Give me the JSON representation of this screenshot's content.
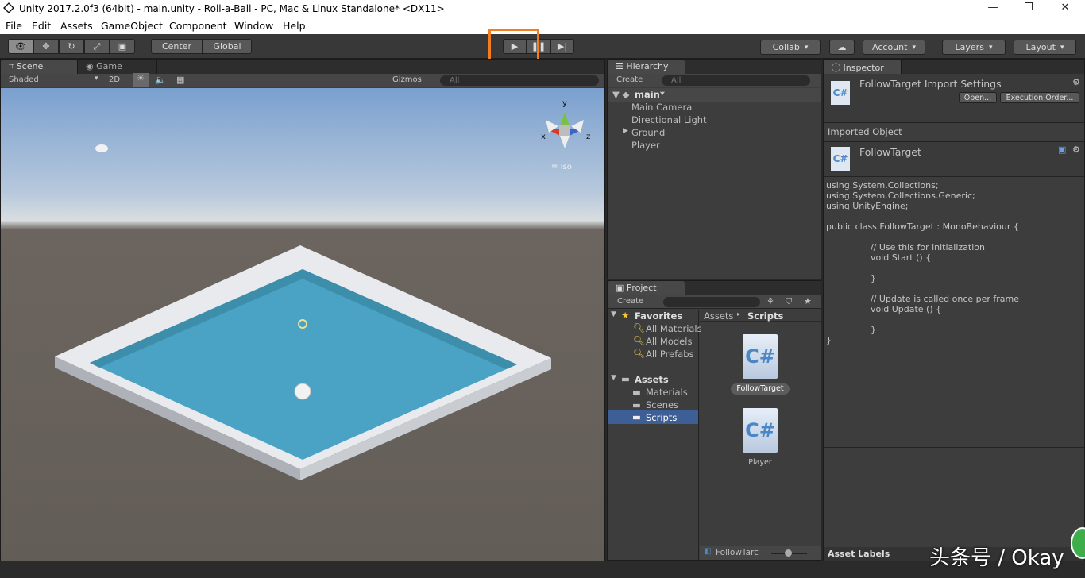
{
  "window": {
    "title": "Unity 2017.2.0f3 (64bit) - main.unity - Roll-a-Ball - PC, Mac & Linux Standalone* <DX11>"
  },
  "menu": [
    "File",
    "Edit",
    "Assets",
    "GameObject",
    "Component",
    "Window",
    "Help"
  ],
  "toolbar": {
    "center": "Center",
    "global": "Global",
    "collab": "Collab",
    "account": "Account",
    "layers": "Layers",
    "layout": "Layout"
  },
  "scene": {
    "tabs": [
      "Scene",
      "Game"
    ],
    "shading": "Shaded",
    "mode_2d": "2D",
    "gizmos": "Gizmos",
    "search_placeholder": "All",
    "gizmo_axes": {
      "y": "y",
      "x": "x",
      "z": "z"
    },
    "projection": "Iso"
  },
  "hierarchy": {
    "tab": "Hierarchy",
    "create": "Create",
    "search_placeholder": "All",
    "scene_name": "main*",
    "items": [
      "Main Camera",
      "Directional Light",
      "Ground",
      "Player"
    ]
  },
  "project": {
    "tab": "Project",
    "create": "Create",
    "favorites_label": "Favorites",
    "favorites": [
      "All Materials",
      "All Models",
      "All Prefabs"
    ],
    "assets_label": "Assets",
    "folders": [
      "Materials",
      "Scenes",
      "Scripts"
    ],
    "breadcrumb_root": "Assets",
    "breadcrumb_current": "Scripts",
    "files": [
      "FollowTarget",
      "Player"
    ],
    "footer_file": "FollowTarc"
  },
  "inspector": {
    "tab": "Inspector",
    "title": "FollowTarget Import Settings",
    "open_btn": "Open...",
    "exec_btn": "Execution Order...",
    "imported_object": "Imported Object",
    "object_name": "FollowTarget",
    "code": "using System.Collections;\nusing System.Collections.Generic;\nusing UnityEngine;\n\npublic class FollowTarget : MonoBehaviour {\n\n                // Use this for initialization\n                void Start () {\n\n                }\n\n                // Update is called once per frame\n                void Update () {\n\n                }\n}",
    "asset_labels": "Asset Labels"
  },
  "watermark": "头条号 / Okay",
  "colors": {
    "highlight": "#f47d20",
    "selection": "#3e5f96",
    "water": "#4aa3c4"
  }
}
